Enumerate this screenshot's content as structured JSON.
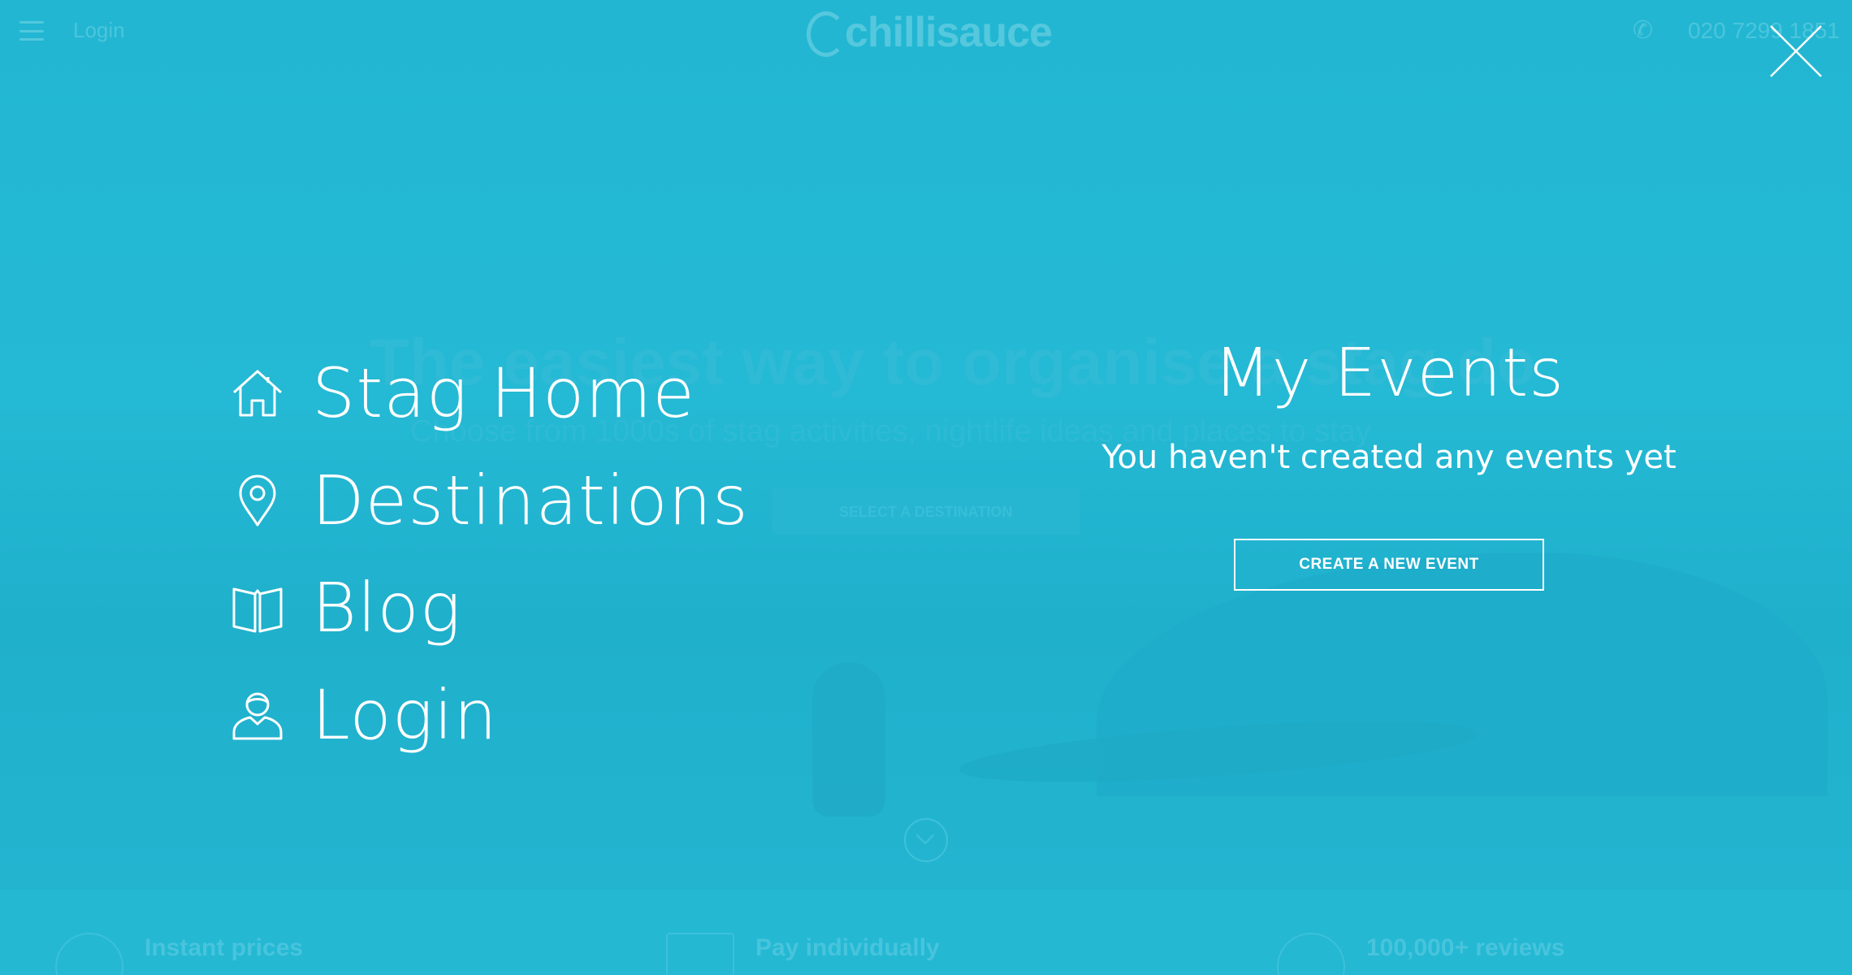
{
  "background": {
    "header": {
      "login_label": "Login",
      "logo_text": "chillisauce",
      "phone": "020 7299 1851"
    },
    "hero": {
      "headline": "The easiest way to organise a stag do",
      "subheadline": "Choose from 1000s of stag activities, nightlife ideas and places to stay",
      "select_button": "SELECT A DESTINATION"
    },
    "features": [
      {
        "label": "Instant prices"
      },
      {
        "label": "Pay individually"
      },
      {
        "label": "100,000+ reviews"
      }
    ]
  },
  "menu": {
    "items": [
      {
        "label": "Stag Home",
        "icon": "home-icon"
      },
      {
        "label": "Destinations",
        "icon": "map-pin-icon"
      },
      {
        "label": "Blog",
        "icon": "book-icon"
      },
      {
        "label": "Login",
        "icon": "user-icon"
      }
    ]
  },
  "events": {
    "title": "My Events",
    "empty_message": "You haven't created any events yet",
    "create_button": "CREATE A NEW EVENT"
  },
  "colors": {
    "overlay": "#21b3cf",
    "text": "#ffffff"
  }
}
